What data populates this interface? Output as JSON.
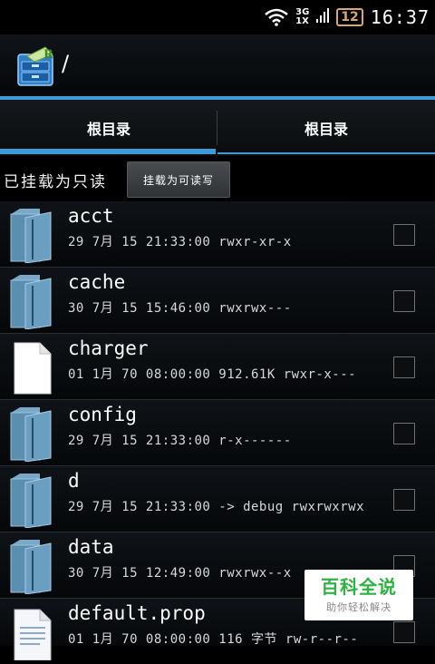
{
  "status_bar": {
    "network_top": "3G",
    "network_bottom": "1X",
    "battery": "12",
    "clock": "16:37"
  },
  "header": {
    "path": "/"
  },
  "tabs": [
    {
      "label": "根目录",
      "active": true
    },
    {
      "label": "根目录",
      "active": false
    }
  ],
  "mount": {
    "status": "已挂载为只读",
    "button_label": "挂载为可读写"
  },
  "files": [
    {
      "name": "acct",
      "meta": "29 7月 15 21:33:00  rwxr-xr-x",
      "type": "folder"
    },
    {
      "name": "cache",
      "meta": "30 7月 15 15:46:00  rwxrwx---",
      "type": "folder"
    },
    {
      "name": "charger",
      "meta": "01 1月 70 08:00:00 912.61K rwxr-x---",
      "type": "file"
    },
    {
      "name": "config",
      "meta": "29 7月 15 21:33:00  r-x------",
      "type": "folder"
    },
    {
      "name": "d",
      "meta": "29 7月 15 21:33:00 -> debug rwxrwxrwx",
      "type": "folder"
    },
    {
      "name": "data",
      "meta": "30 7月 15 12:49:00  rwxrwx--x",
      "type": "folder"
    },
    {
      "name": "default.prop",
      "meta": "01 1月 70 08:00:00 116 字节 rw-r--r--",
      "type": "textfile"
    }
  ],
  "watermark": {
    "title": "百科全说",
    "subtitle": "助你轻松解决"
  },
  "colors": {
    "accent": "#3d9ad6",
    "folder": "#5b8fb0",
    "watermark_green": "#2db342"
  }
}
